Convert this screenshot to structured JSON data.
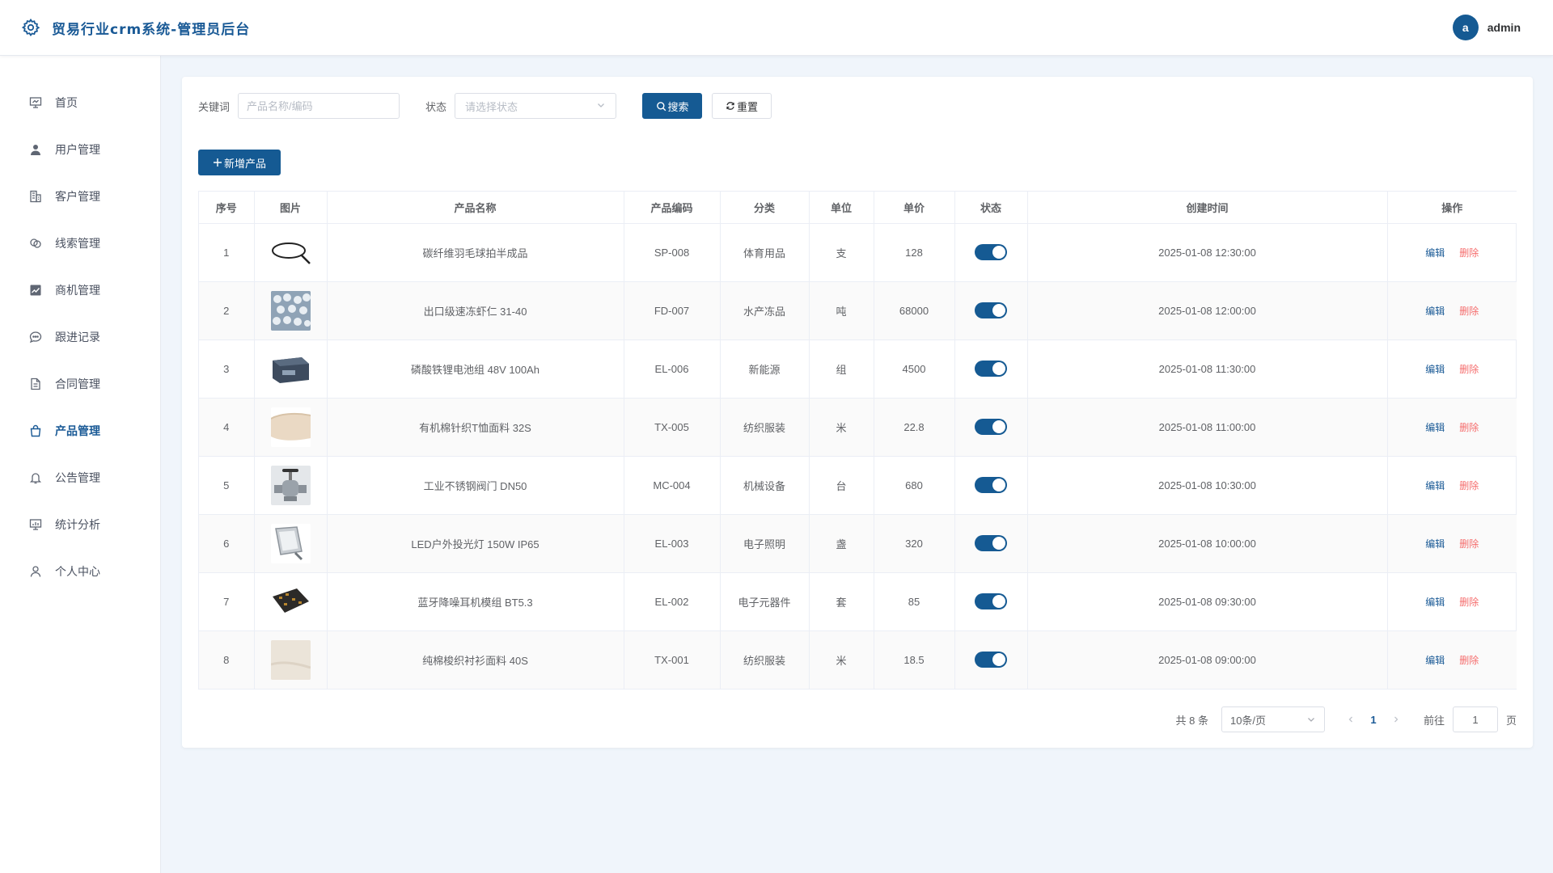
{
  "app": {
    "title": "贸易行业crm系统-管理员后台",
    "user": {
      "avatar_letter": "a",
      "name": "admin"
    }
  },
  "sidebar": {
    "items": [
      {
        "label": "首页",
        "icon": "presentation-icon",
        "active": false
      },
      {
        "label": "用户管理",
        "icon": "user-icon",
        "active": false
      },
      {
        "label": "客户管理",
        "icon": "building-icon",
        "active": false
      },
      {
        "label": "线索管理",
        "icon": "link-icon",
        "active": false
      },
      {
        "label": "商机管理",
        "icon": "trend-chart-icon",
        "active": false
      },
      {
        "label": "跟进记录",
        "icon": "chat-icon",
        "active": false
      },
      {
        "label": "合同管理",
        "icon": "document-icon",
        "active": false
      },
      {
        "label": "产品管理",
        "icon": "shopping-bag-icon",
        "active": true
      },
      {
        "label": "公告管理",
        "icon": "bell-icon",
        "active": false
      },
      {
        "label": "统计分析",
        "icon": "data-board-icon",
        "active": false
      },
      {
        "label": "个人中心",
        "icon": "user-outline-icon",
        "active": false
      }
    ]
  },
  "filters": {
    "keyword_label": "关键词",
    "keyword_placeholder": "产品名称/编码",
    "keyword_value": "",
    "status_label": "状态",
    "status_placeholder": "请选择状态",
    "search_label": "搜索",
    "reset_label": "重置"
  },
  "toolbar": {
    "add_label": "新增产品"
  },
  "table": {
    "columns": [
      "序号",
      "图片",
      "产品名称",
      "产品编码",
      "分类",
      "单位",
      "单价",
      "状态",
      "创建时间",
      "操作"
    ],
    "rows": [
      {
        "index": "1",
        "name": "碳纤维羽毛球拍半成品",
        "code": "SP-008",
        "category": "体育用品",
        "unit": "支",
        "price": "128",
        "status_on": true,
        "created": "2025-01-08 12:30:00"
      },
      {
        "index": "2",
        "name": "出口级速冻虾仁 31-40",
        "code": "FD-007",
        "category": "水产冻品",
        "unit": "吨",
        "price": "68000",
        "status_on": true,
        "created": "2025-01-08 12:00:00"
      },
      {
        "index": "3",
        "name": "磷酸铁锂电池组 48V 100Ah",
        "code": "EL-006",
        "category": "新能源",
        "unit": "组",
        "price": "4500",
        "status_on": true,
        "created": "2025-01-08 11:30:00"
      },
      {
        "index": "4",
        "name": "有机棉针织T恤面料 32S",
        "code": "TX-005",
        "category": "纺织服装",
        "unit": "米",
        "price": "22.8",
        "status_on": true,
        "created": "2025-01-08 11:00:00"
      },
      {
        "index": "5",
        "name": "工业不锈钢阀门 DN50",
        "code": "MC-004",
        "category": "机械设备",
        "unit": "台",
        "price": "680",
        "status_on": true,
        "created": "2025-01-08 10:30:00"
      },
      {
        "index": "6",
        "name": "LED户外投光灯 150W IP65",
        "code": "EL-003",
        "category": "电子照明",
        "unit": "盏",
        "price": "320",
        "status_on": true,
        "created": "2025-01-08 10:00:00"
      },
      {
        "index": "7",
        "name": "蓝牙降噪耳机模组 BT5.3",
        "code": "EL-002",
        "category": "电子元器件",
        "unit": "套",
        "price": "85",
        "status_on": true,
        "created": "2025-01-08 09:30:00"
      },
      {
        "index": "8",
        "name": "纯棉梭织衬衫面料 40S",
        "code": "TX-001",
        "category": "纺织服装",
        "unit": "米",
        "price": "18.5",
        "status_on": true,
        "created": "2025-01-08 09:00:00"
      }
    ],
    "actions": {
      "edit": "编辑",
      "delete": "删除"
    }
  },
  "pagination": {
    "total_text": "共 8 条",
    "page_size": "10条/页",
    "current_page": "1",
    "goto_label": "前往",
    "goto_value": "1",
    "page_suffix": "页"
  },
  "colors": {
    "primary": "#155a93",
    "danger": "#f56c6c",
    "background": "#f0f5fb"
  }
}
